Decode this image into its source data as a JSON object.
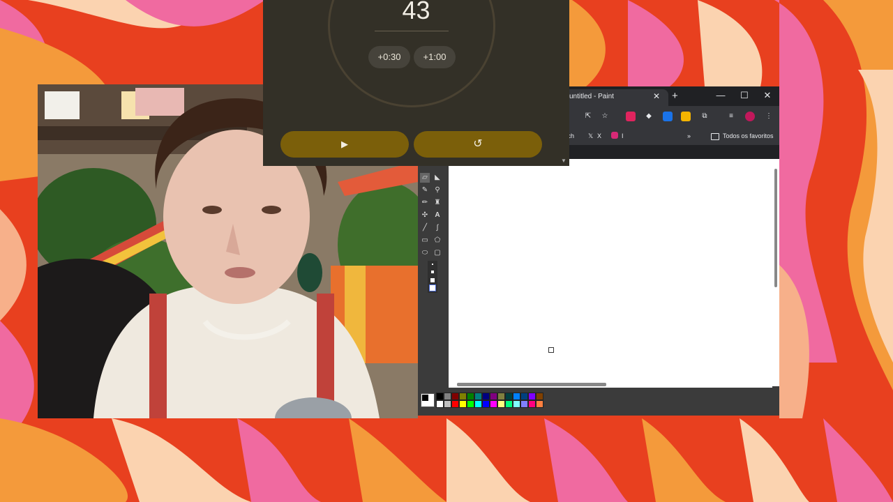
{
  "timer": {
    "time": "43",
    "add_30": "+0:30",
    "add_60": "+1:00",
    "play_icon": "play-icon",
    "reset_icon": "reset-icon"
  },
  "browser": {
    "tab_title": "untitled - Paint",
    "tab_close": "✕",
    "new_tab": "+",
    "minimize": "—",
    "maximize": "☐",
    "close": "✕",
    "bookmarks": [
      {
        "label": "itch"
      },
      {
        "label": "X"
      },
      {
        "label": "I"
      }
    ],
    "bookmarks_more": "»",
    "all_bookmarks": "Todos os favoritos"
  },
  "paint": {
    "palette_colors": [
      "#000000",
      "#808080",
      "#800000",
      "#808000",
      "#008000",
      "#008080",
      "#000080",
      "#800080",
      "#808040",
      "#004040",
      "#0080ff",
      "#004080",
      "#8000ff",
      "#804000",
      "#ffffff",
      "#c0c0c0",
      "#ff0000",
      "#ffff00",
      "#00ff00",
      "#00ffff",
      "#0000ff",
      "#ff00ff",
      "#ffff80",
      "#00ff80",
      "#80ffff",
      "#8080ff",
      "#ff0080",
      "#ff8040"
    ]
  },
  "colors": {
    "timer_bg": "#333027",
    "timer_button": "#7b5f0a",
    "browser_bg": "#202124",
    "background_orange": "#f26b2a",
    "background_pink": "#f06aa0"
  }
}
